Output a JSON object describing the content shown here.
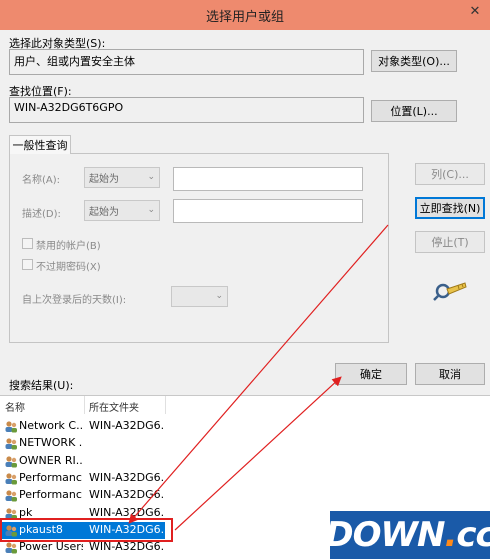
{
  "window": {
    "title": "选择用户或组",
    "close_glyph": "✕"
  },
  "object_type": {
    "label": "选择此对象类型(S):",
    "value": "用户、组或内置安全主体",
    "button": "对象类型(O)..."
  },
  "location": {
    "label": "查找位置(F):",
    "value": "WIN-A32DG6T6GPO",
    "button": "位置(L)..."
  },
  "general_query": {
    "tab_label": "一般性查询",
    "name_label": "名称(A):",
    "name_mode": "起始为",
    "desc_label": "描述(D):",
    "desc_mode": "起始为",
    "disabled_accounts": "禁用的帐户(B)",
    "non_expiring_pw": "不过期密码(X)",
    "days_since_login": "自上次登录后的天数(I):"
  },
  "side_buttons": {
    "columns": "列(C)...",
    "find_now": "立即查找(N)",
    "stop": "停止(T)"
  },
  "actions": {
    "ok": "确定",
    "cancel": "取消"
  },
  "results": {
    "label": "搜索结果(U):",
    "columns": [
      "名称",
      "所在文件夹"
    ],
    "rows": [
      {
        "name": "Network C...",
        "folder": "WIN-A32DG6...",
        "selected": false
      },
      {
        "name": "NETWORK ...",
        "folder": "",
        "selected": false
      },
      {
        "name": "OWNER RI...",
        "folder": "",
        "selected": false
      },
      {
        "name": "Performanc...",
        "folder": "WIN-A32DG6...",
        "selected": false
      },
      {
        "name": "Performanc...",
        "folder": "WIN-A32DG6...",
        "selected": false
      },
      {
        "name": "pk",
        "folder": "WIN-A32DG6...",
        "selected": false
      },
      {
        "name": "pkaust8",
        "folder": "WIN-A32DG6...",
        "selected": true
      },
      {
        "name": "Power Users",
        "folder": "WIN-A32DG6...",
        "selected": false
      }
    ]
  },
  "watermark": {
    "main": "DOWN",
    "dot": ".",
    "suffix": "cc"
  },
  "colors": {
    "titlebar": "#ee8a6e",
    "selection": "#0078d7",
    "annotation": "#e02020",
    "watermark_bg": "#1a5aa8"
  }
}
